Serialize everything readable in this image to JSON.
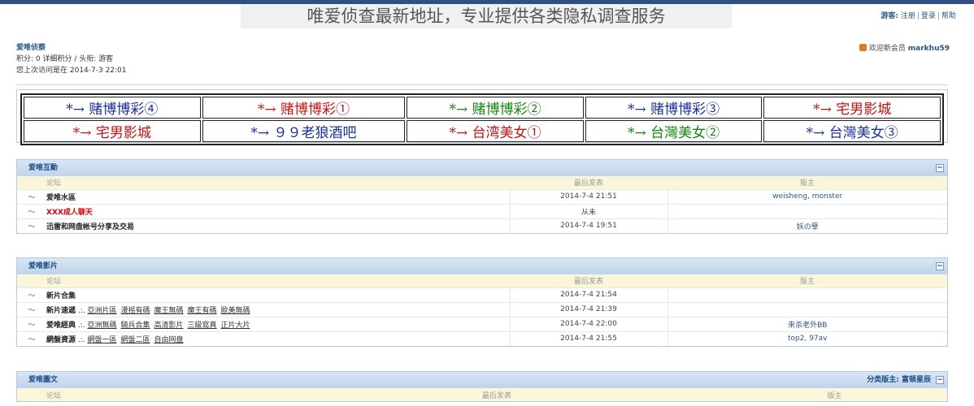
{
  "banner_title": "唯爱侦查最新地址，专业提供各类隐私调查服务",
  "top_links": {
    "guest": "游客:",
    "register": "注册",
    "login": "登录",
    "help": "帮助"
  },
  "user": {
    "name": "爱唯侦察",
    "points": "积分: 0 详细积分 / 头衔: 游客",
    "last_visit": "您上次访问是在 2014-7-3 22:01"
  },
  "welcome": {
    "text": "欢迎新会员",
    "member": "markhu59"
  },
  "ads": [
    [
      {
        "text": "*→ 赌博博彩④",
        "color": "blue"
      },
      {
        "text": "*→ 赌博博彩①",
        "color": "red"
      },
      {
        "text": "*→ 赌博博彩②",
        "color": "green"
      },
      {
        "text": "*→ 赌博博彩③",
        "color": "blue"
      },
      {
        "text": "*→ 宅男影城",
        "color": "red"
      }
    ],
    [
      {
        "text": "*→ 宅男影城",
        "color": "red"
      },
      {
        "text": "*→ ９９老狼酒吧",
        "color": "blue"
      },
      {
        "text": "*→ 台湾美女①",
        "color": "red"
      },
      {
        "text": "*→ 台灣美女②",
        "color": "green"
      },
      {
        "text": "*→ 台灣美女③",
        "color": "blue"
      }
    ]
  ],
  "columns": {
    "forum": "论坛",
    "last_post": "最后发表",
    "moderator": "版主"
  },
  "sections": [
    {
      "title": "爱唯互動",
      "rows": [
        {
          "name": "爱唯水區",
          "last_post": "2014-7-4 21:51",
          "moderator": "weisheng, monster"
        },
        {
          "name": "XXX成人聊天",
          "last_post": "从未",
          "moderator": "",
          "red": true
        },
        {
          "name": "迅雷和网盘帐号分享及交易",
          "last_post": "2014-7-4 19:51",
          "moderator": "妖の孽"
        }
      ]
    },
    {
      "title": "爱唯影片",
      "rows": [
        {
          "name": "新片合集",
          "last_post": "2014-7-4 21:54",
          "moderator": ""
        },
        {
          "name": "新片速遞",
          "subs": [
            "亞洲片區",
            "漫摇有碼",
            "魔王無碼",
            "魔王有碼",
            "歐美無碼"
          ],
          "last_post": "2014-7-4 21:39",
          "moderator": ""
        },
        {
          "name": "爱唯經典",
          "subs": [
            "亞洲無碼",
            "騎兵合集",
            "高清影片",
            "三級寫真",
            "正片大片"
          ],
          "last_post": "2014-7-4 22:00",
          "moderator": "来杀老外BB"
        },
        {
          "name": "網盤資源",
          "subs": [
            "網盤一區",
            "網盤二區",
            "自由网盘"
          ],
          "last_post": "2014-7-4 21:55",
          "moderator": "top2, 97av"
        }
      ]
    },
    {
      "title": "爱唯圖文",
      "moderators_label": "分类版主: 富顿星辰",
      "rows": []
    }
  ],
  "colors": {
    "header_blue": "#1d4b86",
    "column_bg": "#fbf5d9",
    "ad_red": "#cc1111",
    "ad_blue": "#1a2ea5",
    "ad_green": "#118811"
  }
}
